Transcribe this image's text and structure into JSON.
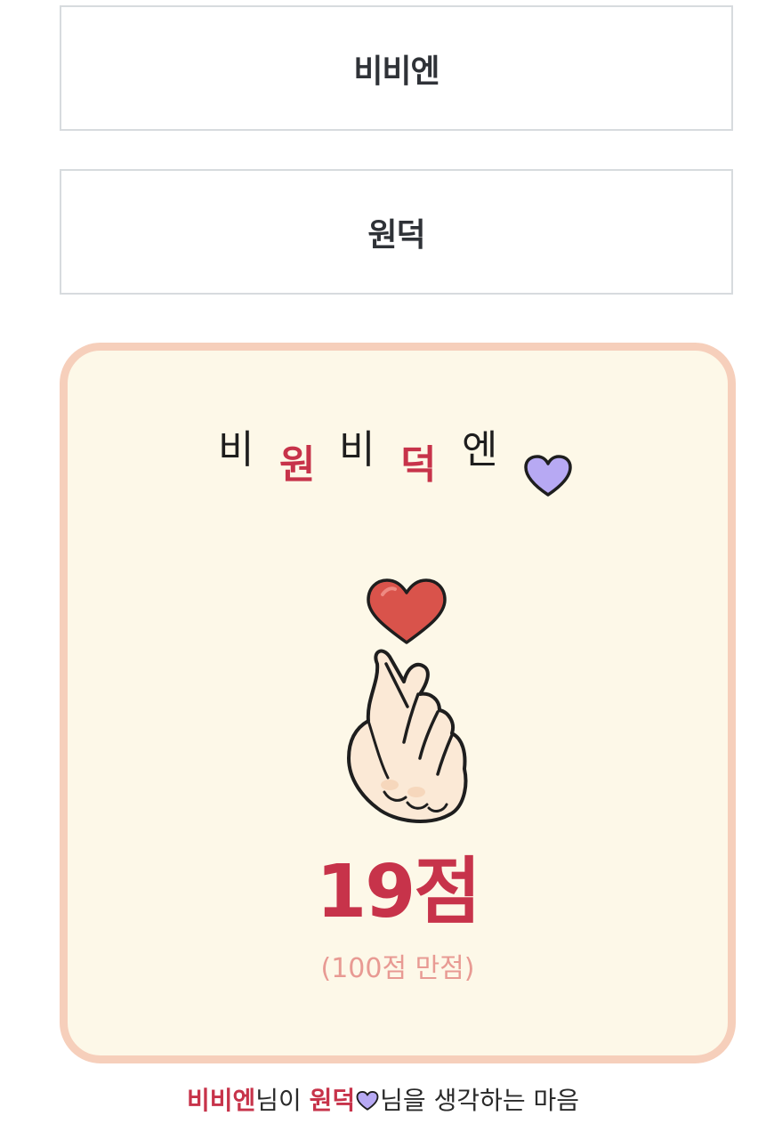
{
  "answers": {
    "first_name": "비비엔",
    "second_name": "원덕"
  },
  "result": {
    "title_chars": [
      "비",
      "원",
      "비",
      "덕",
      "엔"
    ],
    "heart_icon": "purple-heart-icon",
    "illustration_icon": "finger-heart-icon",
    "score": "19점",
    "max_note": "(100점 만점)"
  },
  "caption": {
    "name_a": "비비엔",
    "suffix_a": "님이 ",
    "name_b": "원덕",
    "suffix_b": "님을 생각하는 마음"
  },
  "colors": {
    "accent": "#c7334a",
    "card_bg": "#fdf8e8",
    "card_border": "#f6cfbb",
    "heart_purple": "#b7a9f3",
    "subtle_pink": "#e89a93"
  }
}
